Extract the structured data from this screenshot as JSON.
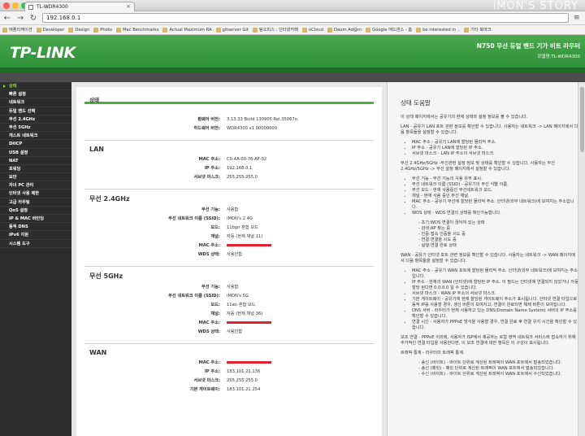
{
  "browser": {
    "tab_title": "TL-WDR4300",
    "url": "192.168.0.1",
    "watermark": "iMON'S STORY",
    "bookmarks": [
      "애플리케이션",
      "Developer",
      "Design",
      "Photo",
      "Mac Benchmarks",
      "Actual Maximum RA",
      "gitserver Git",
      "팀오피스 : 인터넷카페",
      "uCloud",
      "Daum Ad@m",
      "Google 애드센스 - 홈",
      "be interested in ..",
      "기타 북마크"
    ]
  },
  "header": {
    "logo": "TP-LINK",
    "product": "N750 무선 듀얼 밴드 기가 비트 라우터",
    "model": "모델명:TL-WDR4300"
  },
  "sidebar": {
    "items": [
      "상태",
      "빠른 설정",
      "네트워크",
      "듀얼 밴드 선택",
      "무선 2.4GHz",
      "무선 5GHz",
      "게스트 네트워크",
      "DHCP",
      "USB 설정",
      "NAT",
      "포워딩",
      "보안",
      "자녀 PC 관리",
      "인터넷 사용 제한",
      "고급 라우팅",
      "QoS 설정",
      "IP & MAC 바인딩",
      "동적 DNS",
      "IPv6 지원",
      "시스템 도구"
    ],
    "active": 0
  },
  "status": {
    "title": "상태",
    "firmware_label": "펌웨어 버전:",
    "firmware": "3.13.33 Build 130905 Rel.35067n",
    "hardware_label": "하드웨어 버전:",
    "hardware": "WDR4300 v1 00000000",
    "lan": {
      "title": "LAN",
      "mac_label": "MAC 주소:",
      "mac": "C0-4A-00-76-AF-02",
      "ip_label": "IP 주소:",
      "ip": "192.168.0.1",
      "mask_label": "서브넷 마스크:",
      "mask": "255.255.255.0"
    },
    "w24": {
      "title": "무선 2.4GHz",
      "func_label": "무선 기능:",
      "func": "사용함",
      "ssid_label": "무선 네트워크 이름 (SSID):",
      "ssid": "iMON's 2.4G",
      "mode_label": "모드:",
      "mode": "11bgn 혼합 모드",
      "channel_label": "채널:",
      "channel": "자동 (현재 채널 11)",
      "mac_label": "MAC 주소:",
      "wds_label": "WDS 상태:",
      "wds": "사용안함"
    },
    "w5": {
      "title": "무선 5GHz",
      "func_label": "무선 기능:",
      "func": "사용함",
      "ssid_label": "무선 네트워크 이름 (SSID):",
      "ssid": "iMON's 5G",
      "mode_label": "모드:",
      "mode": "11an 혼합 모드",
      "channel_label": "채널:",
      "channel": "자동 (현재 채널 36)",
      "mac_label": "MAC 주소:",
      "wds_label": "WDS 상태:",
      "wds": "사용안함"
    },
    "wan": {
      "title": "WAN",
      "mac_label": "MAC 주소:",
      "ip_label": "IP 주소:",
      "ip": "183.101.21.136",
      "mask_label": "서브넷 마스크:",
      "mask": "255.255.255.0",
      "gw_label": "기본 게이트웨이:",
      "gw": "183.101.21.254"
    }
  },
  "help": {
    "title": "상태 도움말",
    "intro": "이 상태 페이지에서는 공유기의 현재 상태와 설정 정보를 볼 수 있습니다.",
    "lan_p": "LAN - 공유기 LAN 포트 관련 정보를 확인할 수 있습니다. 사용자는 네트워크 -> LAN 페이지에서 다음 항목들을 설정할 수 있습니다.",
    "lan_items": [
      "MAC 주소 - 공유기 LAN에 할당된 물리적 주소.",
      "IP 주소 - 공유기 LAN에 할당된 IP 주소.",
      "서브넷 마스크 - LAN IP 주소의 서브넷 마스크."
    ],
    "wl_p": "무선 2.4GHz/5GHz -무선관련 설정 정보 및 상태를 확인할 수 있습니다. 사용자는 무선 2.4GHz/5GHz -> 무선 설정 페이지에서 설정할 수 있습니다.",
    "wl_items": [
      "무선 기능 - 무선 기능의 사용 유무 표시.",
      "무선 네트워크 이름 (SSID) - 공유기의 무선 식별 이름.",
      "무선 모드 - 현재 사용중인 무선네트워크 모드.",
      "채널 - 현재 사용 중인 무선 채널.",
      "MAC 주소 - 공유기 무선에 할당된 물리적 주소. 인터넷(외부 네트워크)에 보여지는 주소입니다.",
      "WDS 상태 - WDS 연결의 상태를 확인가능합니다."
    ],
    "wds_sub": [
      "초기:WDS 연결이 끊어져 있는 상태",
      "검색:AP 찾는 중",
      "인증:접속 인증을 시도 중",
      "연결:연결을 시도 중",
      "실행:연결 완료 상태"
    ],
    "wan_p": "WAN - 공유기 인터넷 포트 관련 정보를 확인할 수 있습니다. 사용자는 네트워크 -> WAN 페이지에서 다음 항목들을 설정할 수 있습니다.",
    "wan_items": [
      "MAC 주소 - 공유기 WAN 포트에 할당된 물리적 주소. 인터넷(외부 네트워크)에 보여지는 주소입니다.",
      "IP 주소 - 현재의 WAN (인터넷)에 할당된 IP 주소. 이 필드는 인터넷에 연결되지 않았거나 자동 할당 된다면 0.0.0.0 일 수 있습니다.",
      "서브넷 마스크 - WAN IP 주소의 서브넷 마스크.",
      "기본 게이트웨이 - 공유기에 현재 할당된 게이트웨이 주소가 표시됩니다. 인터넷 연결 타입으로 동적 IP를 사용할 경우, 갱신 버튼이 보여지고, 연결이 완료되면 해제 버튼이 보여집니다.",
      "DNS 서버 - 라우터가 현재 사용하고 있는 DNS(Domain Name System) 서버의 IP 주소를 확인할 수 있습니다.",
      "연결 시간 - 사용자가 PPPoE 방식을 사용할 경우, 연결 완료 후 연결 유지 시간을 확인할 수 있습니다."
    ],
    "pppoe_p": "보조 연결 - PPPoE 이외에, 사용자가 ISP에서 제공하는 로컬 영역 네트워크 서비스에 접속하기 위해 추가적인 연결 타입을 사용한다면, 이 보조 연결에 대한 항목은 이 구성이 표시됩니다.",
    "traffic_p": "트래픽 통계 - 라우터의 트래픽 통계.",
    "traffic_sub": [
      "송신 (바이트) - 바이트 단위로 계산된 트래픽이 WAN 포트에서 발송되었습니다.",
      "송신 (패킷) - 패킷 단위로 계산된 트래픽이 WAN 포트에서 발송되었습니다.",
      "수신 (바이트) - 바이트 단위로 계산된 트래픽이 WAN 포트에서 수신되었습니다."
    ]
  }
}
